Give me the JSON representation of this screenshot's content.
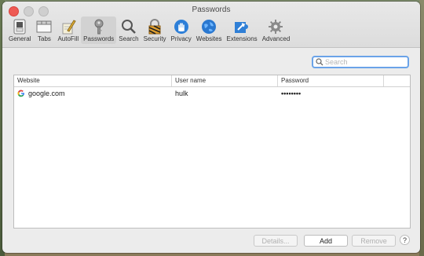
{
  "window": {
    "title": "Passwords"
  },
  "toolbar": {
    "items": [
      {
        "label": "General",
        "icon": "general-switch-icon"
      },
      {
        "label": "Tabs",
        "icon": "tabs-icon"
      },
      {
        "label": "AutoFill",
        "icon": "autofill-pencil-icon"
      },
      {
        "label": "Passwords",
        "icon": "key-icon",
        "selected": true
      },
      {
        "label": "Search",
        "icon": "magnifier-icon"
      },
      {
        "label": "Security",
        "icon": "lock-icon"
      },
      {
        "label": "Privacy",
        "icon": "hand-icon"
      },
      {
        "label": "Websites",
        "icon": "globe-icon"
      },
      {
        "label": "Extensions",
        "icon": "puzzle-icon"
      },
      {
        "label": "Advanced",
        "icon": "gear-icon"
      }
    ]
  },
  "search": {
    "placeholder": "Search",
    "value": ""
  },
  "table": {
    "columns": [
      "Website",
      "User name",
      "Password"
    ],
    "rows": [
      {
        "website": "google.com",
        "username": "hulk",
        "password": "••••••••",
        "favicon": "google-g-icon"
      }
    ]
  },
  "buttons": {
    "details": "Details...",
    "add": "Add",
    "remove": "Remove",
    "help": "?"
  },
  "colors": {
    "selected_tab_bg": "#d2d2d2",
    "search_focus": "#6aa3e8",
    "close_light": "#ee5a53"
  }
}
